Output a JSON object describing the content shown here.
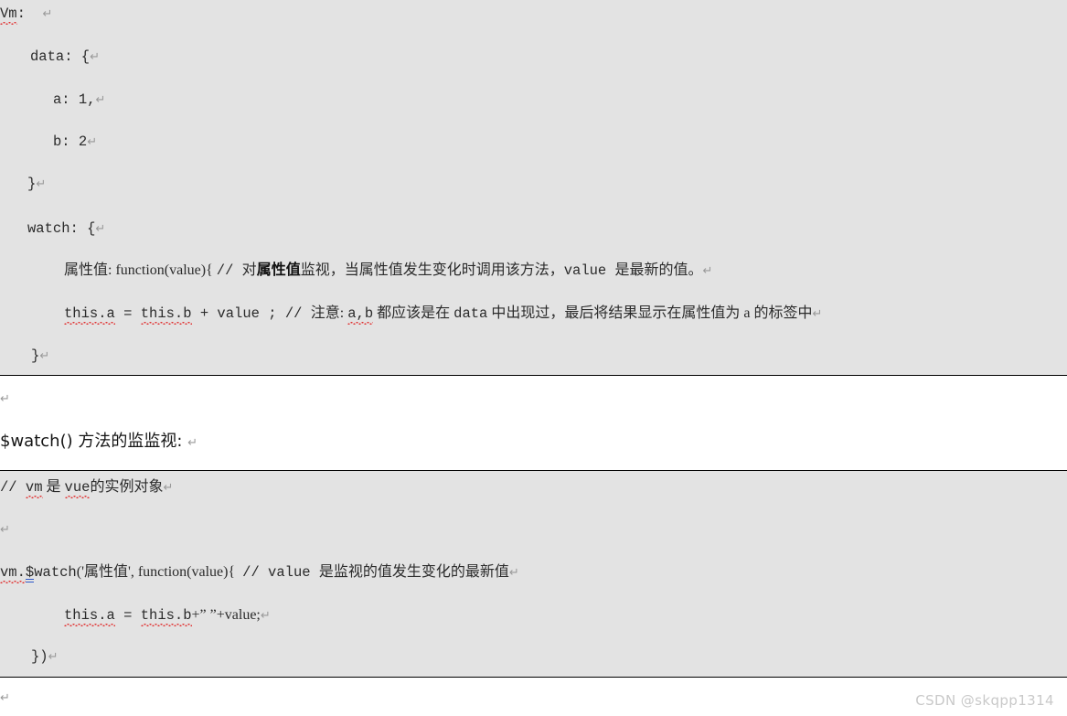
{
  "document": {
    "watermark": "CSDN @skqpp1314",
    "pilcrow": "↵"
  },
  "block1": {
    "name": "vm-watch-option-code-block",
    "background": "#e3e3e3",
    "lines": [
      {
        "id": "l1",
        "indent": 0,
        "pre": "",
        "mid": "",
        "text": "Vm:"
      },
      {
        "id": "l2",
        "indent": 33,
        "text": "data: {"
      },
      {
        "id": "l3",
        "indent": 58,
        "text": "a: 1,"
      },
      {
        "id": "l4",
        "indent": 58,
        "text": "b: 2"
      },
      {
        "id": "l5",
        "indent": 30,
        "text": "}"
      },
      {
        "id": "l6",
        "indent": 30,
        "text": "watch: {"
      },
      {
        "id": "l7",
        "indent": 70,
        "text": "属性值: function(value){ // 对"
      },
      {
        "id": "l8",
        "indent": 70,
        "text": "this.a = this.b + value ; // 注意: a,b 都应该是在 data 中出现过，最后将结果显示在属性值为 a 的标签中"
      },
      {
        "id": "l9",
        "indent": 34,
        "text": "}"
      }
    ],
    "line7": {
      "code_head": "属性值: function(value){ ",
      "comment_slash": "// ",
      "cjk_pre": "对",
      "cjk_bold": "属性值",
      "cjk_post": "监视，当属性值发生变化时调用该方法，",
      "code_tail": "value ",
      "cjk_end": "是最新的值。"
    },
    "line8": {
      "code_head": "this.a",
      "op1": " = ",
      "code_mid": "this.b",
      "op2": " + value ; ",
      "comment_slash": "// ",
      "cjk_pre": "注意: ",
      "ident": "a,b",
      "cjk_mid": " 都应该是在 ",
      "ident2": "data",
      "cjk_post": " 中出现过，最后将结果显示在属性值为 a 的标签中"
    }
  },
  "between": {
    "empty_line": "",
    "heading": "$watch() 方法的监监视:"
  },
  "block2": {
    "name": "vm-dollar-watch-code-block",
    "background": "#e3e3e3",
    "comment_line": {
      "slash": "// ",
      "vm": "vm",
      "cjk1": " 是 ",
      "vue": "vue",
      "cjk2": "的实例对象"
    },
    "empty_line": "",
    "watch_call": {
      "vm_dot": "vm.",
      "dollar": "$",
      "watch": "watch",
      "args_head": "('属性值', function(value){  ",
      "comment_slash": "// ",
      "comment_code": "value ",
      "comment_cjk": "是监视的值发生变化的最新值"
    },
    "assign_line": {
      "this_a": "this.a",
      "op1": " = ",
      "this_b": "this.b",
      "tail": "+” ”+value;"
    },
    "close_line": "})"
  },
  "footer": {
    "empty_line": ""
  }
}
